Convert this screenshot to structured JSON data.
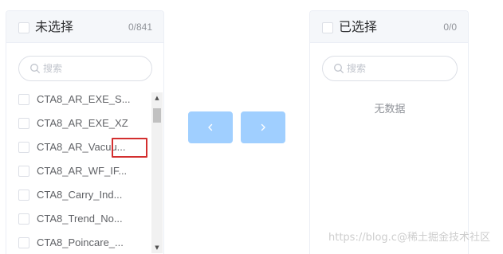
{
  "source_panel": {
    "title": "未选择",
    "count": "0/841",
    "search_placeholder": "搜索",
    "items": [
      {
        "label": "CTA8_AR_EXE_S..."
      },
      {
        "label": "CTA8_AR_EXE_XZ"
      },
      {
        "label": "CTA8_AR_Vacuu..."
      },
      {
        "label": "CTA8_AR_WF_IF..."
      },
      {
        "label": "CTA8_Carry_Ind..."
      },
      {
        "label": "CTA8_Trend_No..."
      },
      {
        "label": "CTA8_Poincare_..."
      }
    ]
  },
  "target_panel": {
    "title": "已选择",
    "count": "0/0",
    "search_placeholder": "搜索",
    "empty_text": "无数据"
  },
  "buttons": {
    "move_left_icon": "chevron-left-icon",
    "move_right_icon": "chevron-right-icon"
  },
  "watermark": "https://blog.c@稀土掘金技术社区",
  "colors": {
    "button_bg": "#a0cfff",
    "header_bg": "#f5f7fa",
    "border": "#ebeef5",
    "highlight": "#d32f2f",
    "text": "#606266",
    "muted": "#909399"
  }
}
